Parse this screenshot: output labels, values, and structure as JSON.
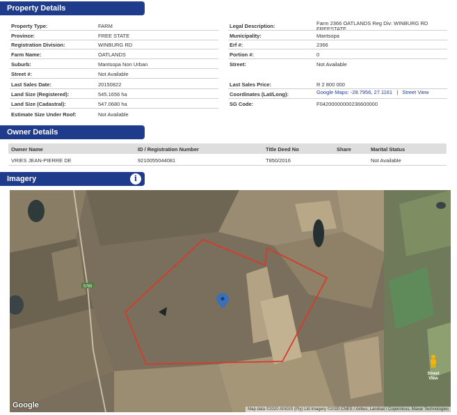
{
  "property_details": {
    "title": "Property Details",
    "left": [
      {
        "label": "Property Type:",
        "value": "FARM"
      },
      {
        "label": "Province:",
        "value": "FREE STATE"
      },
      {
        "label": "Registration Division:",
        "value": "WINBURG RD"
      },
      {
        "label": "Farm Name:",
        "value": "OATLANDS"
      },
      {
        "label": "Suburb:",
        "value": "Mantsopa Non Urban"
      },
      {
        "label": "Street #:",
        "value": "Not Available"
      },
      {
        "label": "Last Sales Date:",
        "value": "20150822"
      },
      {
        "label": "Land Size (Registered):",
        "value": "545.1656 ha"
      },
      {
        "label": "Land Size (Cadastral):",
        "value": "547.0680 ha"
      },
      {
        "label": "Estimate Size Under Roof:",
        "value": "Not Available"
      }
    ],
    "right": [
      {
        "label": "Legal Description:",
        "value_line1": "Farm 2366 OATLANDS Reg Div: WINBURG RD",
        "value_line2": "FREESTATE"
      },
      {
        "label": "Municipality:",
        "value": "Mantsopa"
      },
      {
        "label": "Erf #:",
        "value": "2366"
      },
      {
        "label": "Portion #:",
        "value": "0"
      },
      {
        "label": "Street:",
        "value": "Not Available"
      },
      {
        "label": "Last Sales Price:",
        "value": "R 2 800 000"
      },
      {
        "label": "Coordinates (Lat/Long):",
        "value": "Google Maps: -28.7956, 27.1161",
        "separator": "|",
        "link": "Street View"
      },
      {
        "label": "SG Code:",
        "value": "F04200000000236600000"
      }
    ]
  },
  "owner_details": {
    "title": "Owner Details",
    "columns": [
      "Owner Name",
      "ID / Registration Number",
      "Title Deed No",
      "Share",
      "Marital Status"
    ],
    "rows": [
      {
        "owner_name": "VRIES JEAN-PIERRE DE",
        "id": "9210055044081",
        "title_deed": "T850/2016",
        "share": "",
        "marital_status": "Not Available"
      }
    ]
  },
  "imagery": {
    "title": "Imagery",
    "info_icon": "info-icon",
    "road_label": "S785",
    "google_logo": "Google",
    "pegman_label_line1": "Street",
    "pegman_label_line2": "View",
    "attribution": "Map data ©2020 AfriGIS (Pty) Ltd Imagery ©2020 CNES / Airbus, Landsat / Copernicus, Maxar Technologies",
    "boundary_color": "#d63a2a",
    "marker_color": "#3d6fb6"
  }
}
